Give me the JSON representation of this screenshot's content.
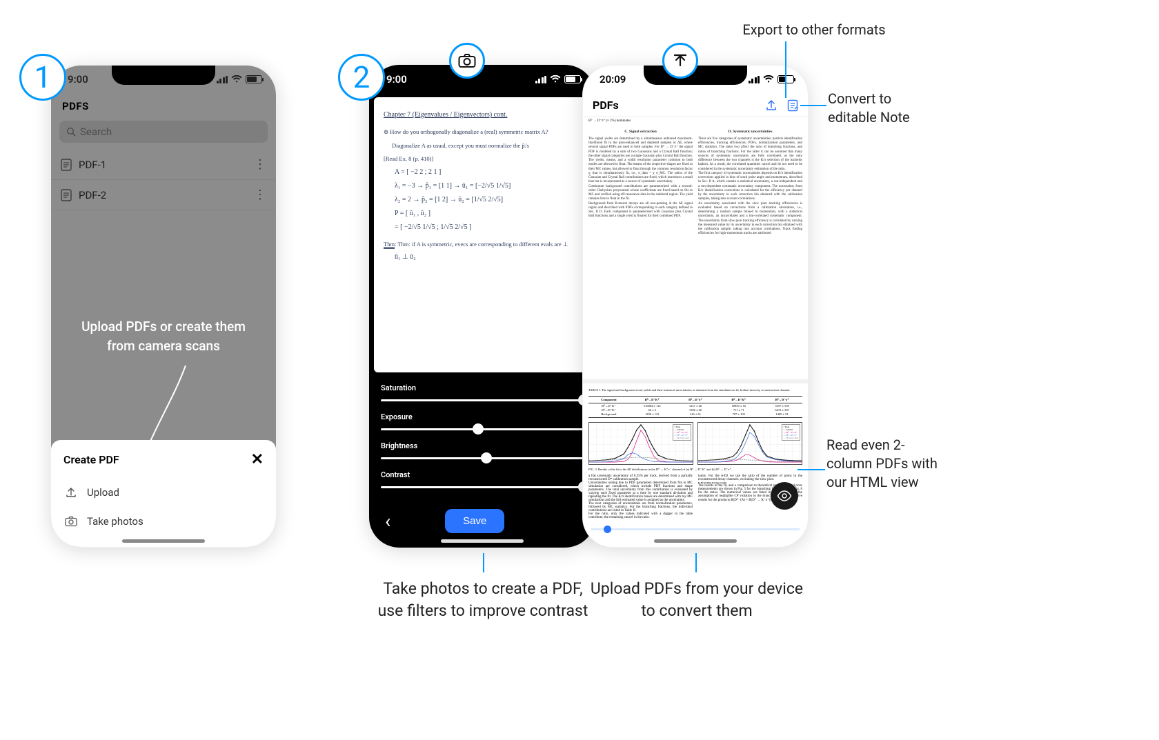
{
  "steps": {
    "one": "1",
    "two": "2"
  },
  "statusbar": {
    "time_a": "9:00",
    "time_b": "9:00",
    "time_c": "20:09"
  },
  "screen1": {
    "header": "PDFS",
    "search_placeholder": "Search",
    "items": [
      {
        "name": "PDF-1"
      },
      {
        "name": "PDF-2"
      }
    ],
    "overlay_text": "Upload PDFs or create them from camera scans",
    "sheet": {
      "title": "Create PDF",
      "opt_upload": "Upload",
      "opt_photos": "Take photos"
    }
  },
  "screen2": {
    "paper": {
      "title": "Chapter 7  (Eigenvalues / Eigenvectors) cont.",
      "q": "How do you orthogonally diagonalize a (real) symmetric matrix A?",
      "line1": "Diagonalize A as usual, except you must normalize the p̂ᵢ's",
      "line2": "[Read Ex. 8 (p. 410)]",
      "eq1": "A = [ −2  2 ;  2  1 ]",
      "eq2": "λ₁ = −3 → p̂₁ = [1 1] → û₁ = [−2/√5  1/√5]",
      "eq3": "λ₂ = 2 → p̂₂ = [1 2] → û₂ = [1/√5  2/√5]",
      "eq4": "P = [ û₁ , û₂ ]",
      "eq5": "   = [ −2/√5  1/√5 ;  1/√5  2/√5 ]",
      "thm": "Thm: if A is symmetric, evecs are corresponding to different evals are ⊥",
      "thm2": "û₁ ⊥ û₂"
    },
    "filters": {
      "saturation": {
        "label": "Saturation",
        "value": 100
      },
      "exposure": {
        "label": "Exposure",
        "value": 48
      },
      "brightness": {
        "label": "Brightness",
        "value": 52
      },
      "contrast": {
        "label": "Contrast",
        "value": 100
      }
    },
    "save_label": "Save"
  },
  "screen3": {
    "header": "PDFs",
    "eqline": "B⁰ → D⁻π⁺  (≈ 2%) dominates",
    "col_left": {
      "h": "C.  Signal extraction",
      "p1": "The signal yields are determined by a simultaneous unbinned maximum-likelihood fit to the pion-enhanced and depleted samples in ΔE, where several signal PDFs are used in both samples. For B⁰ → D⁻π⁺ the signal PDF is modeled by a sum of two Gaussians and a Crystal Ball function; the other signal categories use a single Gaussian plus Crystal Ball function. The yields, means, and a width resolution parameter common to both modes are allowed to float. The means of the respective shapes are fixed to their MC values, but allowed to float through the common resolution factor χ, that is simultaneously fit, i.e., σ_data = χ σ_MC. The ratios of the Gaussian and Crystal Ball contributions are fixed, which introduces a small bias but is incorporated as a source of systematic uncertainty.",
      "p2": "Continuum background contributions are parameterized with a second-order Chebyshev polynomial whose coefficients are fixed based on fits to MC and verified using off-resonance data in the sideband region. The yield remains free to float in the fit.",
      "p3": "Background from B-meson decays are all non-peaking in the ΔE signal region and described with PDFs corresponding to each category defined in Sec. II D. Each component is parameterized with Gaussian plus Crystal Ball functions and a single yield is floated for their combined PDF.",
      "table_caption": "TABLE I. The signal and background event yields and their statistical uncertainties as obtained from the simultaneous fit, broken down by reconstruction channel.",
      "table": {
        "headers": [
          "Component",
          "B⁰→D⁻K⁺",
          "B⁰→D⁻π⁺",
          "B⁰→D⁻K⁺",
          "B⁰→D⁻π⁺"
        ],
        "rows": [
          [
            "B⁰→D⁻K⁺",
            "516884 ± 112",
            "1257 ± 46",
            "18950 ± 16",
            "5557 ± 559"
          ],
          [
            "B⁰→D⁻K⁺",
            "66 ± 3",
            "1396 ± 60",
            "711 ± 71",
            "6413 ± 307"
          ],
          [
            "Background",
            "1296 ± 115",
            "416 ± 61",
            "707 ± 105",
            "1469 ± 91"
          ]
        ]
      },
      "fig_caption": "FIG. 3. Results of the fit to the ΔE distributions in the D⁰ → K⁺π⁻ channel of (a) B⁰ → D⁻K⁺ and (b) B⁰ → D⁻π⁺.",
      "p4": "a flat systematic uncertainty of 0.35% per track, derived from a partially reconstructed D* calibration sample.",
      "p5": "Uncertainties arising due to PDF parameters determined from fits to MC simulation are considered, which include PDF fractions and shape parameters. The total uncertainty from this contribution is evaluated by varying each fixed parameter at a time by one standard deviation and repeating the fit. The K/π identification biases are determined with toy MC simulations and the full estimated value is assigned as the uncertainty.",
      "p6": "The next categories of uncertainties are from normalization parameters, followed by MC statistics. For the branching fractions, the individual contributions are listed in Table II.",
      "p7": "For the ratio, only the values indicated with a dagger in the table contribute; the remaining cancel in the ratio."
    },
    "col_right": {
      "h": "D.  Systematic uncertainties",
      "p1": "There are five categories of systematic uncertainties: particle identification efficiencies, tracking efficiencies, PDFs, normalization parameters, and MC statistics. The latter two affect the ratio of branching fractions, and ratios of branching fractions. For the latter it can be assumed that many sources of systematic uncertainty are fully correlated, as the only difference between the two channels is the K/π selection of the bachelor hadron. As a result, the correlated quantities cancel and do not need to be considered in the systematic uncertainty estimation of the ratio.",
      "p2": "The first category of systematic uncertainties depends on K/π identification corrections applied in bins of track polar angle and momentum, described in Sec. II A, which contain a statistical uncertainty, a run-independent and a run-dependent systematic uncertainty component. The uncertainty from K/π identification corrections is calculated for the efficiency per channel by the uncertainty in each correction bin obtained with the calibration samples, taking into account correlations.",
      "p3": "An uncertainty associated with the slow pion tracking efficiencies is evaluated based on corrections from a calibration calculation, i.e., determining a random sample binned in momentum, with a statistical uncertainty, an uncorrelated and a bin-correlated systematic component. The uncertainty from slow pion tracking efficiency is calculated by varying the measured value by its uncertainty in each correction bin obtained with the calibration sample, taking into account correlations. Track finding efficiencies for high-momentum tracks are attributed",
      "p4": "tainty. For the ϕ-ID we use the ratio of the number of pions in the reconstructed decay channels, excluding the slow pion.",
      "h2": "E.  Branching fraction results",
      "p5": "The results of the fit, and a comparison to theoretical predictions and prior measurements are shown in Fig. 5 for the branching fractions and in Fig. 6 for the ratios. The numerical values are listed in Table III. Under the assumption of negligible CP violation in the branching fractions we give results for the products B(D*⁻(A) × B(D° → K⁻π⁺)) listed in Table IV."
    },
    "chart_legend": [
      "Data",
      "Model",
      "B⁰→D⁻K⁺",
      "B⁰→D⁻π⁺",
      "Background"
    ]
  },
  "captions": {
    "c2": "Take photos to create a PDF,\nuse filters to improve contrast",
    "c3": "Upload PDFs from your device\nto convert them"
  },
  "annotations": {
    "export": "Export to other formats",
    "convert": "Convert to\neditable Note",
    "htmlview": "Read even 2-\ncolumn PDFs with\nour HTML view"
  },
  "chart_data": [
    {
      "type": "line",
      "title": "(a)",
      "xlabel": "ΔE (MeV)",
      "ylabel": "Events / (2 MeV)",
      "xlim": [
        -60,
        60
      ],
      "x": [
        -60,
        -50,
        -40,
        -30,
        -20,
        -15,
        -10,
        -5,
        0,
        5,
        10,
        15,
        20,
        30,
        40,
        50,
        60
      ],
      "series": [
        {
          "name": "Data",
          "values": [
            5,
            6,
            8,
            14,
            30,
            55,
            85,
            120,
            140,
            118,
            80,
            50,
            26,
            12,
            7,
            5,
            4
          ]
        },
        {
          "name": "Model",
          "values": [
            5,
            6,
            8,
            14,
            30,
            55,
            85,
            120,
            140,
            118,
            80,
            50,
            26,
            12,
            7,
            5,
            4
          ]
        },
        {
          "name": "B⁰→D⁻K⁺",
          "values": [
            0,
            0,
            0,
            0,
            2,
            10,
            35,
            80,
            120,
            95,
            55,
            22,
            6,
            1,
            0,
            0,
            0
          ]
        },
        {
          "name": "B⁰→D⁻π⁺",
          "values": [
            0,
            0,
            1,
            4,
            12,
            28,
            35,
            30,
            18,
            10,
            5,
            2,
            1,
            0,
            0,
            0,
            0
          ]
        },
        {
          "name": "Background",
          "values": [
            5,
            6,
            7,
            10,
            14,
            16,
            17,
            18,
            18,
            17,
            16,
            15,
            13,
            11,
            7,
            5,
            4
          ]
        }
      ]
    },
    {
      "type": "line",
      "title": "(b)",
      "xlabel": "ΔE (MeV)",
      "ylabel": "Events / (2 MeV)",
      "xlim": [
        -60,
        60
      ],
      "x": [
        -60,
        -50,
        -40,
        -30,
        -20,
        -15,
        -10,
        -5,
        0,
        5,
        10,
        15,
        20,
        30,
        40,
        50,
        60
      ],
      "series": [
        {
          "name": "Data",
          "values": [
            6,
            7,
            9,
            13,
            22,
            38,
            68,
            110,
            150,
            125,
            82,
            45,
            24,
            12,
            8,
            6,
            5
          ]
        },
        {
          "name": "Model",
          "values": [
            6,
            7,
            9,
            13,
            22,
            38,
            68,
            110,
            150,
            125,
            82,
            45,
            24,
            12,
            8,
            6,
            5
          ]
        },
        {
          "name": "B⁰→D⁻K⁺",
          "values": [
            0,
            0,
            0,
            1,
            3,
            8,
            18,
            30,
            28,
            18,
            9,
            4,
            1,
            0,
            0,
            0,
            0
          ]
        },
        {
          "name": "B⁰→D⁻π⁺",
          "values": [
            0,
            0,
            0,
            2,
            8,
            20,
            42,
            78,
            120,
            104,
            70,
            38,
            20,
            10,
            6,
            4,
            3
          ]
        },
        {
          "name": "Background",
          "values": [
            6,
            7,
            8,
            10,
            11,
            11,
            10,
            9,
            8,
            8,
            7,
            6,
            5,
            4,
            3,
            2,
            2
          ]
        }
      ]
    }
  ]
}
